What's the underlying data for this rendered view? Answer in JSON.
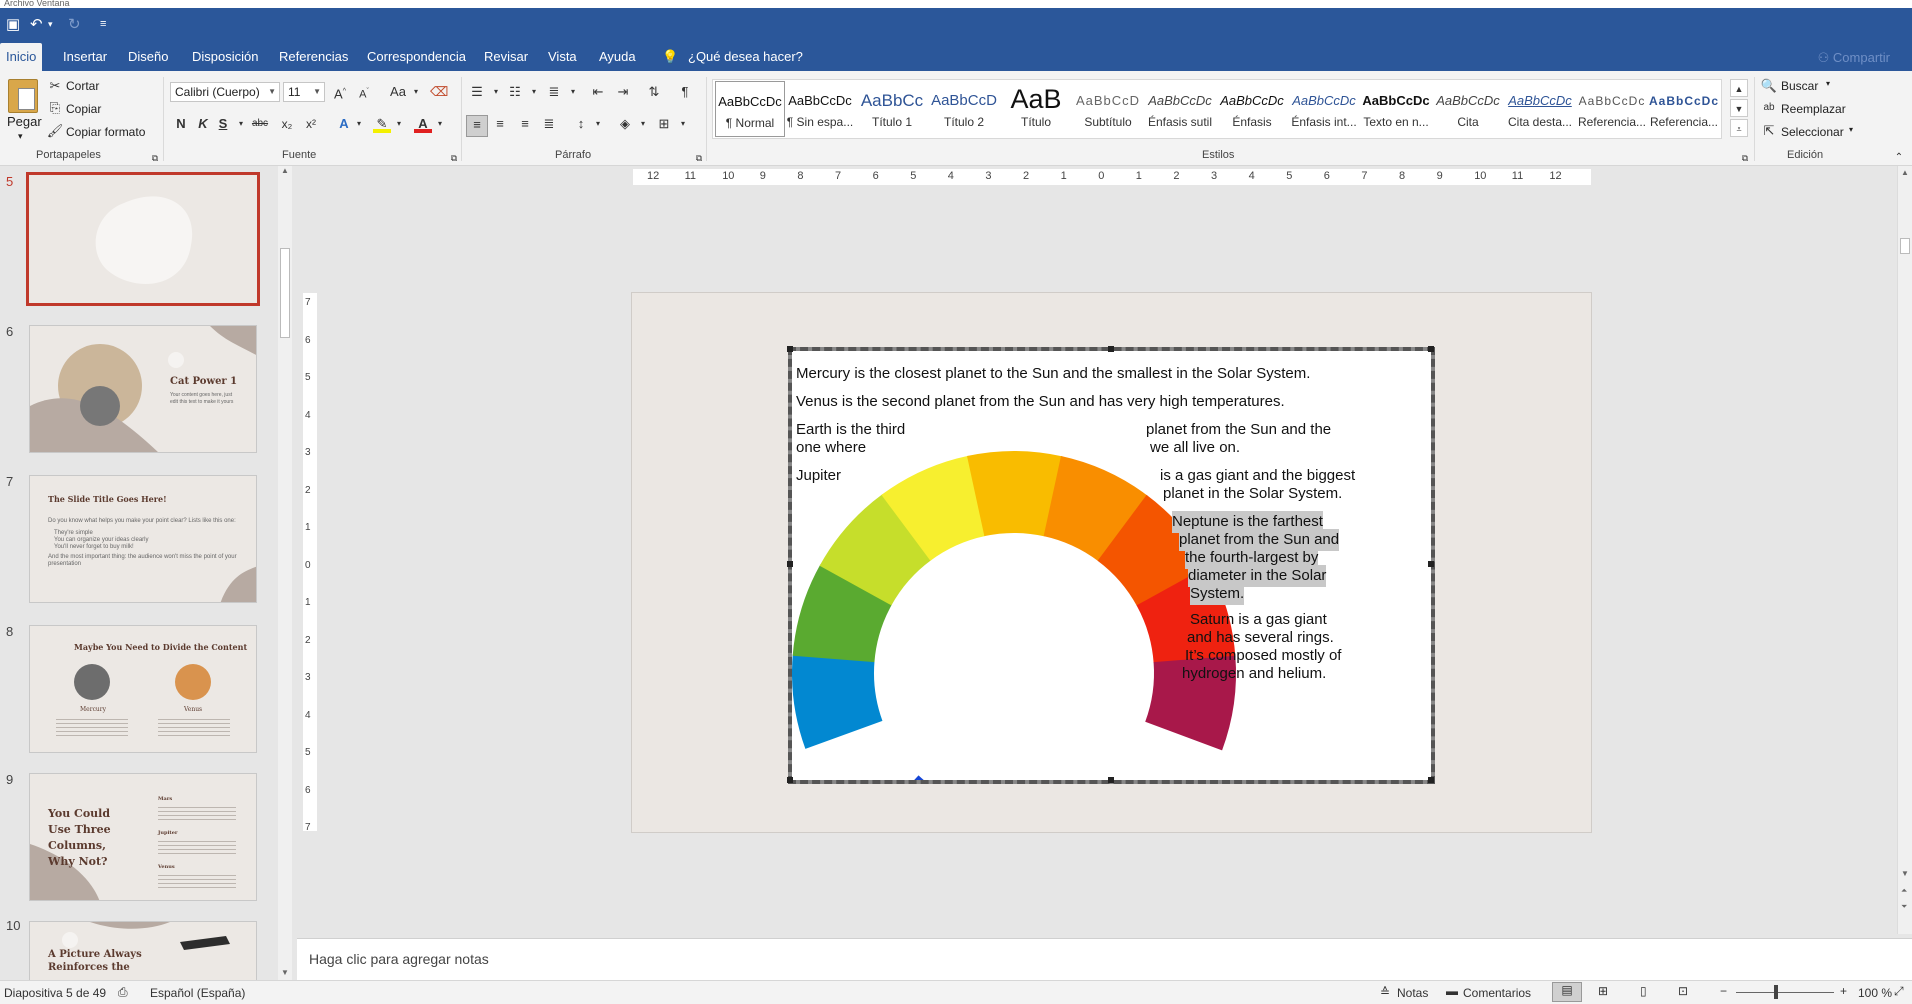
{
  "menu_strip": "Archivo   Ventana",
  "tabs": [
    {
      "label": "Inicio",
      "active": true
    },
    {
      "label": "Insertar"
    },
    {
      "label": "Diseño"
    },
    {
      "label": "Disposición"
    },
    {
      "label": "Referencias"
    },
    {
      "label": "Correspondencia"
    },
    {
      "label": "Revisar"
    },
    {
      "label": "Vista"
    },
    {
      "label": "Ayuda"
    }
  ],
  "tell_me": "¿Qué desea hacer?",
  "share": "Compartir",
  "clipboard": {
    "paste": "Pegar",
    "cut": "Cortar",
    "copy": "Copiar",
    "format_painter": "Copiar formato",
    "group": "Portapapeles"
  },
  "font": {
    "name": "Calibri (Cuerpo)",
    "size": "11",
    "group": "Fuente",
    "change_case": "Aa",
    "bold": "N",
    "italic": "K",
    "underline": "S",
    "strike": "abc",
    "sub": "x₂",
    "sup": "x²"
  },
  "paragraph": {
    "group": "Párrafo"
  },
  "styles": {
    "group": "Estilos",
    "items": [
      {
        "preview": "AaBbCcDc",
        "name": "¶ Normal"
      },
      {
        "preview": "AaBbCcDc",
        "name": "¶ Sin espa..."
      },
      {
        "preview": "AaBbCc",
        "name": "Título 1"
      },
      {
        "preview": "AaBbCcD",
        "name": "Título 2"
      },
      {
        "preview": "AaB",
        "name": "Título"
      },
      {
        "preview": "AaBbCcD",
        "name": "Subtítulo"
      },
      {
        "preview": "AaBbCcDc",
        "name": "Énfasis sutil"
      },
      {
        "preview": "AaBbCcDc",
        "name": "Énfasis"
      },
      {
        "preview": "AaBbCcDc",
        "name": "Énfasis int..."
      },
      {
        "preview": "AaBbCcDc",
        "name": "Texto en n..."
      },
      {
        "preview": "AaBbCcDc",
        "name": "Cita"
      },
      {
        "preview": "AaBbCcDc",
        "name": "Cita desta..."
      },
      {
        "preview": "AaBbCcDc",
        "name": "Referencia..."
      },
      {
        "preview": "AaBbCcDc",
        "name": "Referencia..."
      }
    ]
  },
  "editing": {
    "find": "Buscar",
    "replace": "Reemplazar",
    "select": "Seleccionar",
    "group": "Edición"
  },
  "ruler": {
    "h_ticks": [
      "12",
      "11",
      "10",
      "9",
      "8",
      "7",
      "6",
      "5",
      "4",
      "3",
      "2",
      "1",
      "0",
      "1",
      "2",
      "3",
      "4",
      "5",
      "6",
      "7",
      "8",
      "9",
      "10",
      "11",
      "12"
    ],
    "v_ticks": [
      "7",
      "6",
      "5",
      "4",
      "3",
      "2",
      "1",
      "0",
      "1",
      "2",
      "3",
      "4",
      "5",
      "6",
      "7"
    ]
  },
  "thumbnails": [
    {
      "num": "5",
      "selected": true
    },
    {
      "num": "6",
      "title": "Cat Power 1",
      "body": "Your content goes here, just edit this text to make it yours"
    },
    {
      "num": "7",
      "title": "The Slide Title Goes Here!",
      "intro": "Do you know what helps you make your point clear? Lists like this one:",
      "bullets": [
        "They're simple",
        "You can organize your ideas clearly",
        "You'll never forget to buy milk!"
      ],
      "outro": "And the most important thing: the audience won't miss the point of your presentation"
    },
    {
      "num": "8",
      "title": "Maybe You Need to Divide the Content",
      "col1": "Mercury",
      "col2": "Venus"
    },
    {
      "num": "9",
      "title": "You Could Use Three Columns, Why Not?",
      "heads": [
        "Mars",
        "Jupiter",
        "Venus"
      ]
    },
    {
      "num": "10",
      "title": "A Picture Always Reinforces the"
    }
  ],
  "document": {
    "lines": [
      "Mercury is the closest planet to the Sun and the smallest in the Solar System.",
      "Venus is the second planet from the Sun and has very high temperatures.",
      "Earth is the third",
      "one where",
      "planet from the Sun and the",
      "we all live on.",
      "Jupiter",
      "is a gas giant and the biggest",
      "planet in the Solar System.",
      "Neptune is the farthest",
      "planet from the Sun and",
      "the fourth-largest by",
      "diameter in the Solar",
      "System.",
      "Saturn is a gas giant",
      "and has several rings.",
      "It’s composed mostly of",
      "hydrogen and helium."
    ]
  },
  "wheel_colors": [
    "#0288d1",
    "#5aaa30",
    "#c6de2b",
    "#f7ef2f",
    "#f9bc00",
    "#f98e00",
    "#f45500",
    "#ef2210",
    "#a8184a"
  ],
  "notes_placeholder": "Haga clic para agregar notas",
  "status": {
    "slide_counter": "Diapositiva 5 de 49",
    "language": "Español (España)",
    "notes": "Notas",
    "comments": "Comentarios",
    "zoom": "100 %"
  }
}
